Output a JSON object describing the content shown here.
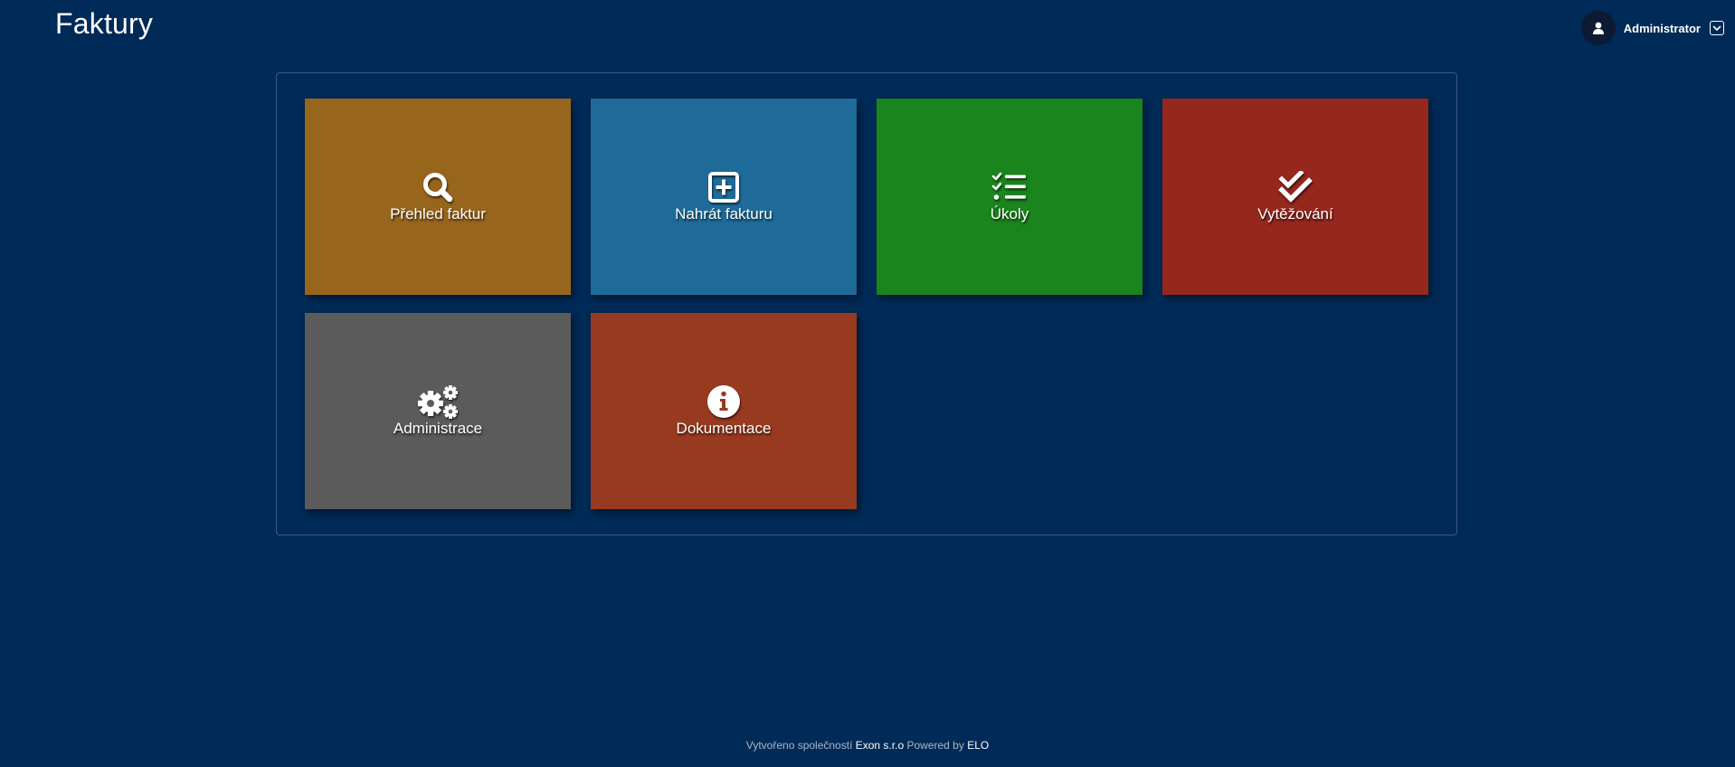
{
  "app": {
    "title": "Faktury"
  },
  "user": {
    "name": "Administrator",
    "avatar_icon": "user-icon",
    "menu_icon": "chevron-down-icon"
  },
  "tiles": [
    {
      "label": "Přehled faktur",
      "icon": "search-icon",
      "color": "#98651c"
    },
    {
      "label": "Nahrát fakturu",
      "icon": "plus-square-icon",
      "color": "#1e6b99"
    },
    {
      "label": "Úkoly",
      "icon": "task-list-icon",
      "color": "#1a841d"
    },
    {
      "label": "Vytěžování",
      "icon": "double-check-icon",
      "color": "#95271d"
    },
    {
      "label": "Administrace",
      "icon": "gears-icon",
      "color": "#5b5b5b"
    },
    {
      "label": "Dokumentace",
      "icon": "info-icon",
      "color": "#983a1f"
    }
  ],
  "footer": {
    "created_by_prefix": "Vytvořeno společností",
    "company": "Exon s.r.o",
    "powered_by_prefix": "Powered by",
    "powered_by": "ELO"
  }
}
